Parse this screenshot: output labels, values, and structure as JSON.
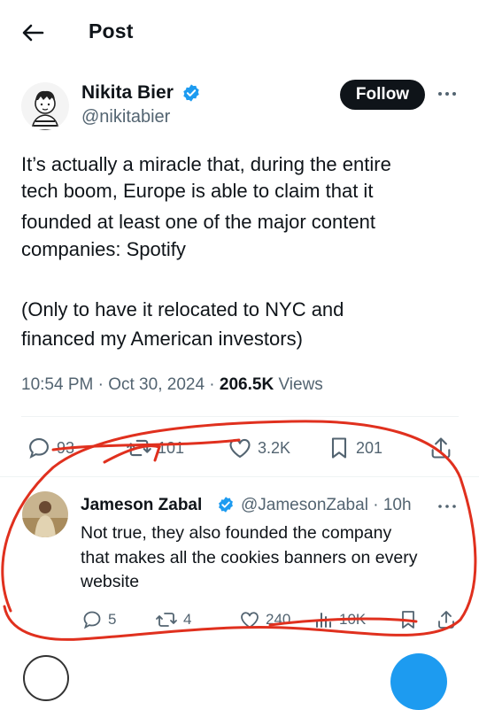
{
  "header": {
    "title": "Post",
    "back_icon": "arrow-left-icon"
  },
  "post": {
    "author": {
      "name": "Nikita Bier",
      "handle": "@nikitabier",
      "verified": true
    },
    "follow_label": "Follow",
    "lines": [
      "It’s actually a miracle that, during the entire",
      "tech boom, Europe is able to claim that it",
      "founded at least one of the major content",
      "companies: Spotify",
      "(Only to have it relocated to NYC and",
      "financed my American investors)"
    ],
    "meta": {
      "time": "10:54 PM",
      "date": "Oct 30, 2024",
      "views_count": "206.5K",
      "views_label": "Views"
    },
    "actions": {
      "replies": "93",
      "reposts": "101",
      "likes": "3.2K",
      "bookmarks": "201"
    }
  },
  "reply": {
    "author": {
      "name": "Jameson Zabal",
      "handle": "@JamesonZabal",
      "age": "10h",
      "verified": true
    },
    "lines": [
      "Not true, they also founded the company",
      "that makes all the cookies banners on every",
      "website"
    ],
    "actions": {
      "replies": "5",
      "reposts": "4",
      "likes": "240",
      "views": "10K"
    }
  },
  "colors": {
    "accent": "#1d9bf0",
    "text": "#0f1419",
    "muted": "#536471",
    "annotation": "#e0301e"
  }
}
